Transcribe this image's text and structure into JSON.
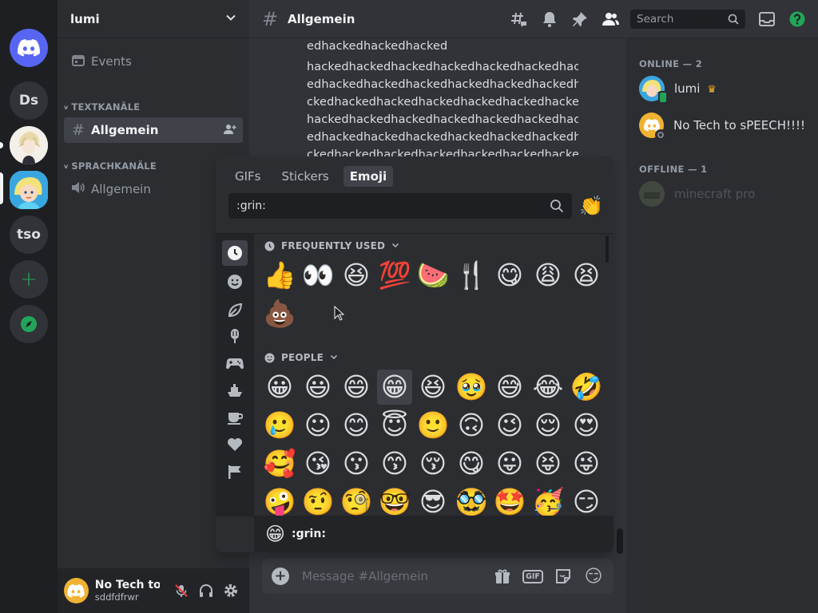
{
  "servers": [
    {
      "label": "",
      "icon": "discord-logo-icon"
    },
    {
      "label": "Ds"
    },
    {
      "label": "",
      "icon": "anime-avatar-server"
    },
    {
      "label": "",
      "icon": "cartoon-avatar-server"
    },
    {
      "label": "tso"
    },
    {
      "label": "+",
      "icon": "add-server-icon"
    },
    {
      "label": "",
      "icon": "explore-compass-icon"
    }
  ],
  "sidebar": {
    "guild_name": "lumi",
    "events_label": "Events",
    "text_category": "TEXTKANÄLE",
    "text_channel": "Allgemein",
    "voice_category": "SPRACHKANÄLE",
    "voice_channel": "Allgemein"
  },
  "user_panel": {
    "display_name": "No Tech to...",
    "username": "sddfdfrwr"
  },
  "header": {
    "channel": "Allgemein",
    "search_placeholder": "Search"
  },
  "messages": [
    "edhackedhackedhacked",
    "hackedhackedhackedhackedhackedhackedhack",
    "edhackedhackedhackedhackedhackedhackedha",
    "ckedhackedhackedhackedhackedhackedhacked",
    "hackedhackedhackedhackedhackedhackedhack",
    "edhackedhackedhackedhackedhackedhackedha",
    "ckedhackedhackedhackedhackedhackedhacked"
  ],
  "members": {
    "online_header": "ONLINE — 2",
    "offline_header": "OFFLINE — 1",
    "online": [
      {
        "name": "lumi",
        "crown": "♛"
      },
      {
        "name": "No Tech to sPEECH!!!!..."
      }
    ],
    "offline": [
      {
        "name": "minecraft pro"
      }
    ]
  },
  "composer": {
    "placeholder": "Message #Allgemein",
    "gif_label": "GIF"
  },
  "picker": {
    "tabs": [
      "GIFs",
      "Stickers",
      "Emoji"
    ],
    "active_tab": "Emoji",
    "search_value": ":grin:",
    "clap": "👏",
    "frequently_used_label": "FREQUENTLY USED",
    "people_label": "PEOPLE",
    "frequent": [
      "👍",
      "👀",
      "😆",
      "💯",
      "🍉",
      "🍴",
      "😋",
      "😩",
      "😫",
      "💩"
    ],
    "people": [
      "😀",
      "😃",
      "😄",
      "😁",
      "😆",
      "🥹",
      "😅",
      "😂",
      "🤣",
      "🥲",
      "☺",
      "😊",
      "😇",
      "🙂",
      "🙃",
      "😉",
      "😌",
      "😍",
      "🥰",
      "😘",
      "😗",
      "😙",
      "😚",
      "😋",
      "😛",
      "😝",
      "😜",
      "🤪",
      "🤨",
      "🧐",
      "🤓",
      "😎",
      "🥸",
      "🤩",
      "🥳",
      "😏"
    ],
    "footer_emoji": "😁",
    "footer_label": ":grin:",
    "highlighted_index": 3
  },
  "colors": {
    "accent_green": "#23a559",
    "brand_yellow": "#f0b232",
    "blurple": "#5865f2"
  }
}
